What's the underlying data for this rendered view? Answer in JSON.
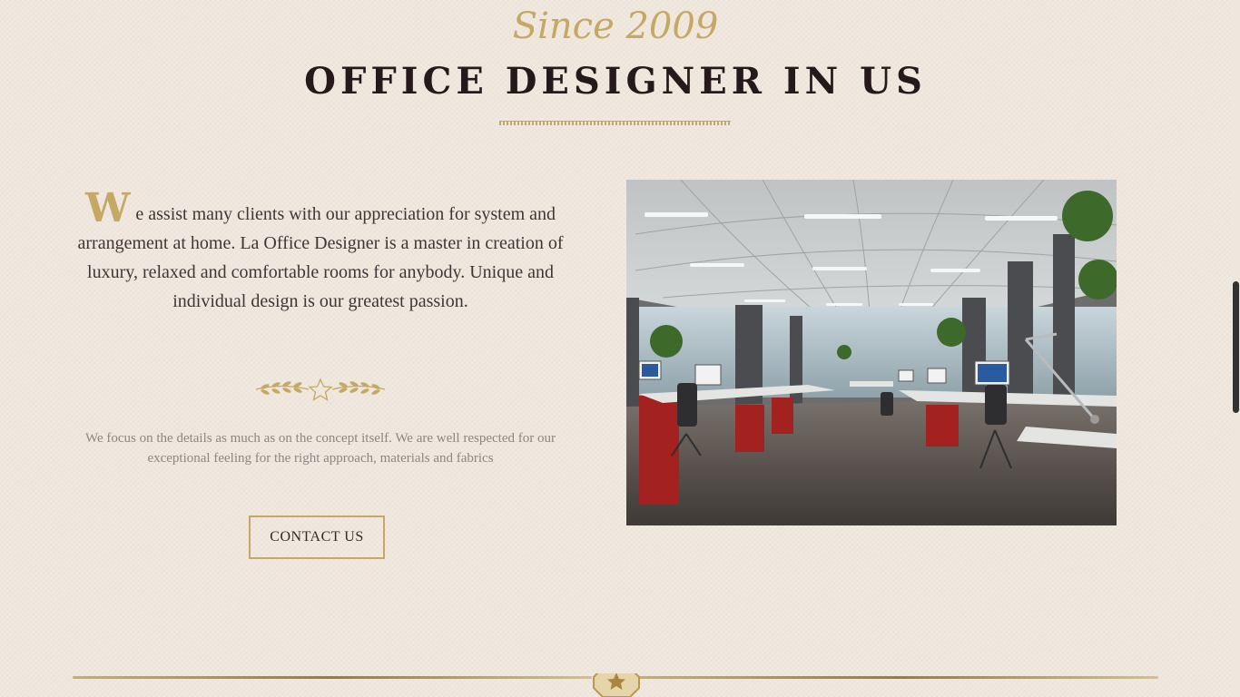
{
  "hero": {
    "since_text": "Since 2009",
    "title": "OFFICE DESIGNER IN US"
  },
  "intro": {
    "dropcap": "W",
    "lead_text": "e assist many clients with our appreciation for system and arrangement at home. La Office Designer is a master in creation of luxury, relaxed and comfortable rooms for anybody. Unique and individual design is our greatest passion.",
    "sub_text": "We focus on the details as much as on the concept itself. We are well respected for our exceptional feeling for the right approach, materials and fabrics",
    "cta_label": "CONTACT US"
  },
  "media": {
    "image_subject": "open-plan-office-photo"
  },
  "icons": {
    "ornament": "laurel-star-icon",
    "footer_badge": "star-badge-icon"
  },
  "colors": {
    "background": "#efe7dd",
    "gold_accent": "#c4a863",
    "heading": "#26191b",
    "body_text": "#3e3635",
    "muted_text": "#8e8680"
  }
}
